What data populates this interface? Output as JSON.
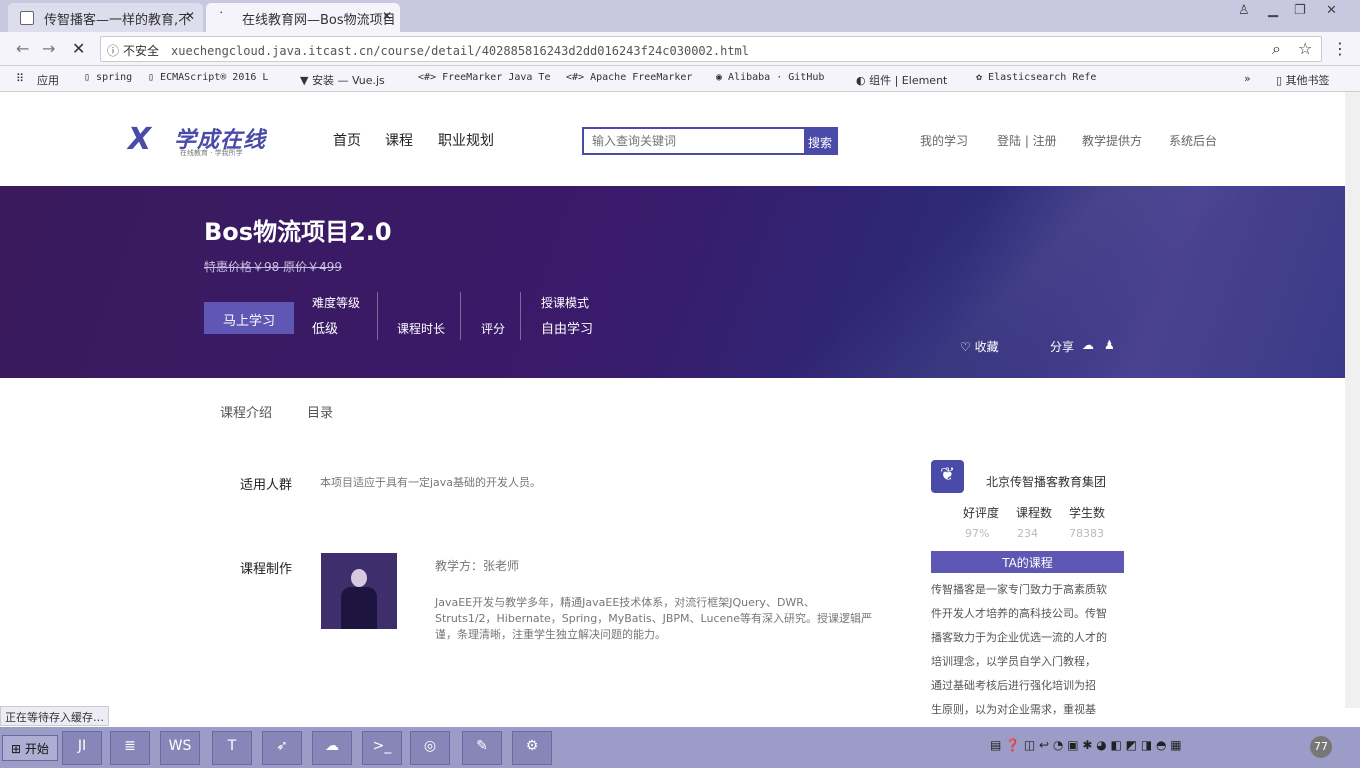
{
  "browser": {
    "tabs": [
      {
        "title": "传智播客—一样的教育,不"
      },
      {
        "title": "在线教育网—Bos物流项目"
      }
    ],
    "url": {
      "insecure": "不安全",
      "text": "xuechengcloud.java.itcast.cn/course/detail/402885816243d2dd016243f24c030002.html"
    },
    "bookmarks": [
      "应用",
      "spring",
      "ECMAScript® 2016 L",
      "安装 — Vue.js",
      "FreeMarker Java Te",
      "Apache FreeMarker",
      "Alibaba · GitHub",
      "组件 | Element",
      "Elasticsearch Refe",
      "»",
      "其他书签"
    ],
    "status": "正在等待存入缓存…"
  },
  "site": {
    "logo_text": "学成在线",
    "logo_slogan": "在线教育 · 学我所学",
    "nav": [
      "首页",
      "课程",
      "职业规划"
    ],
    "search_placeholder": "输入查询关键词",
    "search_button": "搜索",
    "links": [
      "我的学习",
      "登陆 | 注册",
      "教学提供方",
      "系统后台"
    ]
  },
  "course": {
    "title": "Bos物流项目2.0",
    "price": "特惠价格￥98  原价￥499",
    "start_button": "马上学习",
    "difficulty_label": "难度等级",
    "difficulty_value": "低级",
    "duration_label": "课程时长",
    "rating_label": "评分",
    "mode_label": "授课模式",
    "mode_value": "自由学习",
    "favorite": "♡ 收藏",
    "share": "分享"
  },
  "content_tabs": [
    "课程介绍",
    "目录"
  ],
  "audience": {
    "label": "适用人群",
    "text": "本项目适应于具有一定java基础的开发人员。"
  },
  "production": {
    "label": "课程制作",
    "teacher": "教学方：张老师",
    "lines": [
      "JavaEE开发与教学多年，精通JavaEE技术体系，对流行框架JQuery、DWR、",
      "Struts1/2，Hibernate，Spring，MyBatis、JBPM、Lucene等有深入研究。授课逻辑严",
      "谨，条理清晰，注重学生独立解决问题的能力。"
    ]
  },
  "org": {
    "name": "北京传智播客教育集团",
    "stats_labels": [
      "好评度",
      "课程数",
      "学生数"
    ],
    "stats_values": [
      "97%",
      "234",
      "78383"
    ],
    "ta_header": "TA的课程",
    "ta_lines": [
      "传智播客是一家专门致力于高素质软",
      "件开发人才培养的高科技公司。传智",
      "播客致力于为企业优选一流的人才的",
      "培训理念，以学员自学入门教程，",
      "通过基础考核后进行强化培训为招",
      "生原则，以为对企业需求，重视基"
    ]
  },
  "taskbar": {
    "start": "开始",
    "items": [
      "JI",
      "≣",
      "WS",
      "T",
      "➶",
      "☁",
      ">_",
      "◎",
      "✎",
      "⚙"
    ],
    "tray": "77"
  }
}
